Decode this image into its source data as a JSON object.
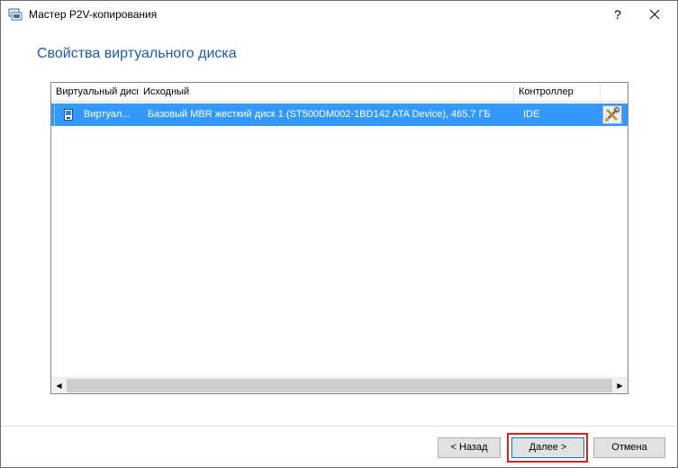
{
  "window": {
    "title": "Мастер P2V-копирования",
    "help_label": "?",
    "close_label": "✕"
  },
  "page": {
    "title": "Свойства виртуального диска"
  },
  "grid": {
    "columns": [
      "Виртуальный диск",
      "Исходный",
      "Контроллер"
    ],
    "rows": [
      {
        "virtual_disk": "Виртуал...",
        "source": "Базовый MBR жесткий диск 1 (ST500DM002-1BD142 ATA Device), 465.7 ГБ",
        "controller": "IDE",
        "selected": true
      }
    ]
  },
  "scrollbar": {
    "left_arrow": "◀",
    "right_arrow": "▶"
  },
  "buttons": {
    "back": "< Назад",
    "next": "Далее >",
    "cancel": "Отмена"
  },
  "colors": {
    "accent": "#3399ff",
    "title": "#1e5b9e",
    "highlight": "#e02020"
  }
}
